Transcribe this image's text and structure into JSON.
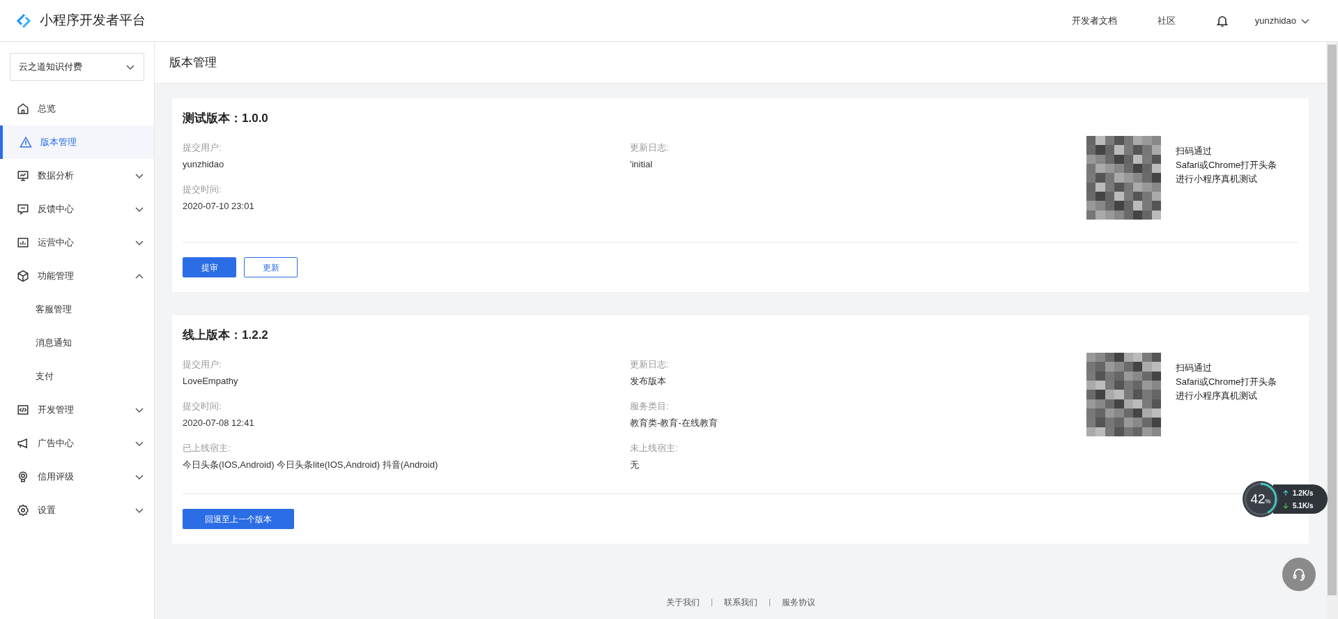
{
  "header": {
    "title": "小程序开发者平台",
    "links": [
      "开发者文档",
      "社区"
    ],
    "user": "yunzhidao"
  },
  "sidebar": {
    "app_selector": "云之道知识付费",
    "items": [
      {
        "kind": "link",
        "label": "总览",
        "selected": false
      },
      {
        "kind": "link",
        "label": "版本管理",
        "selected": true
      },
      {
        "kind": "group",
        "label": "数据分析",
        "selected": false,
        "expanded": false
      },
      {
        "kind": "group",
        "label": "反馈中心",
        "selected": false,
        "expanded": false
      },
      {
        "kind": "group",
        "label": "运营中心",
        "selected": false,
        "expanded": false
      },
      {
        "kind": "group",
        "label": "功能管理",
        "selected": false,
        "expanded": true,
        "children": [
          {
            "label": "客服管理",
            "selected": false
          },
          {
            "label": "消息通知",
            "selected": false
          },
          {
            "label": "支付",
            "selected": false
          }
        ]
      },
      {
        "kind": "group",
        "label": "开发管理",
        "selected": false,
        "expanded": false
      },
      {
        "kind": "group",
        "label": "广告中心",
        "selected": false,
        "expanded": false
      },
      {
        "kind": "group",
        "label": "信用评级",
        "selected": false,
        "expanded": false
      },
      {
        "kind": "group",
        "label": "设置",
        "selected": false,
        "expanded": false
      }
    ]
  },
  "page_title": "版本管理",
  "versions": [
    {
      "title": "测试版本：1.0.0",
      "left_fields": [
        {
          "label": "提交用户:",
          "value": "yunzhidao"
        },
        {
          "label": "提交时间:",
          "value": "2020-07-10 23:01"
        }
      ],
      "right_fields": [
        {
          "label": "更新日志:",
          "value": "'initial"
        }
      ],
      "qr_caption": [
        "扫码通过",
        "Safari或Chrome打开头条",
        "进行小程序真机测试"
      ],
      "buttons": [
        {
          "label": "提审",
          "kind": "primary"
        },
        {
          "label": "更新",
          "kind": "outline"
        }
      ]
    },
    {
      "title": "线上版本：1.2.2",
      "left_fields": [
        {
          "label": "提交用户:",
          "value": "LoveEmpathy"
        },
        {
          "label": "提交时间:",
          "value": "2020-07-08 12:41"
        },
        {
          "label": "已上线宿主:",
          "value": "今日头条(IOS,Android) 今日头条lite(IOS,Android) 抖音(Android)"
        }
      ],
      "right_fields": [
        {
          "label": "更新日志:",
          "value": "发布版本"
        },
        {
          "label": "服务类目:",
          "value": "教育类-教育-在线教育"
        },
        {
          "label": "未上线宿主:",
          "value": "无"
        }
      ],
      "qr_caption": [
        "扫码通过",
        "Safari或Chrome打开头条",
        "进行小程序真机测试"
      ],
      "buttons": [
        {
          "label": "回退至上一个版本",
          "kind": "primary_wide"
        }
      ]
    }
  ],
  "footer_links": [
    "关于我们",
    "联系我们",
    "服务协议"
  ],
  "network_monitor": {
    "percent": "42",
    "unit": "%",
    "level": 0.42,
    "upload": "1.2K/s",
    "download": "5.1K/s"
  }
}
